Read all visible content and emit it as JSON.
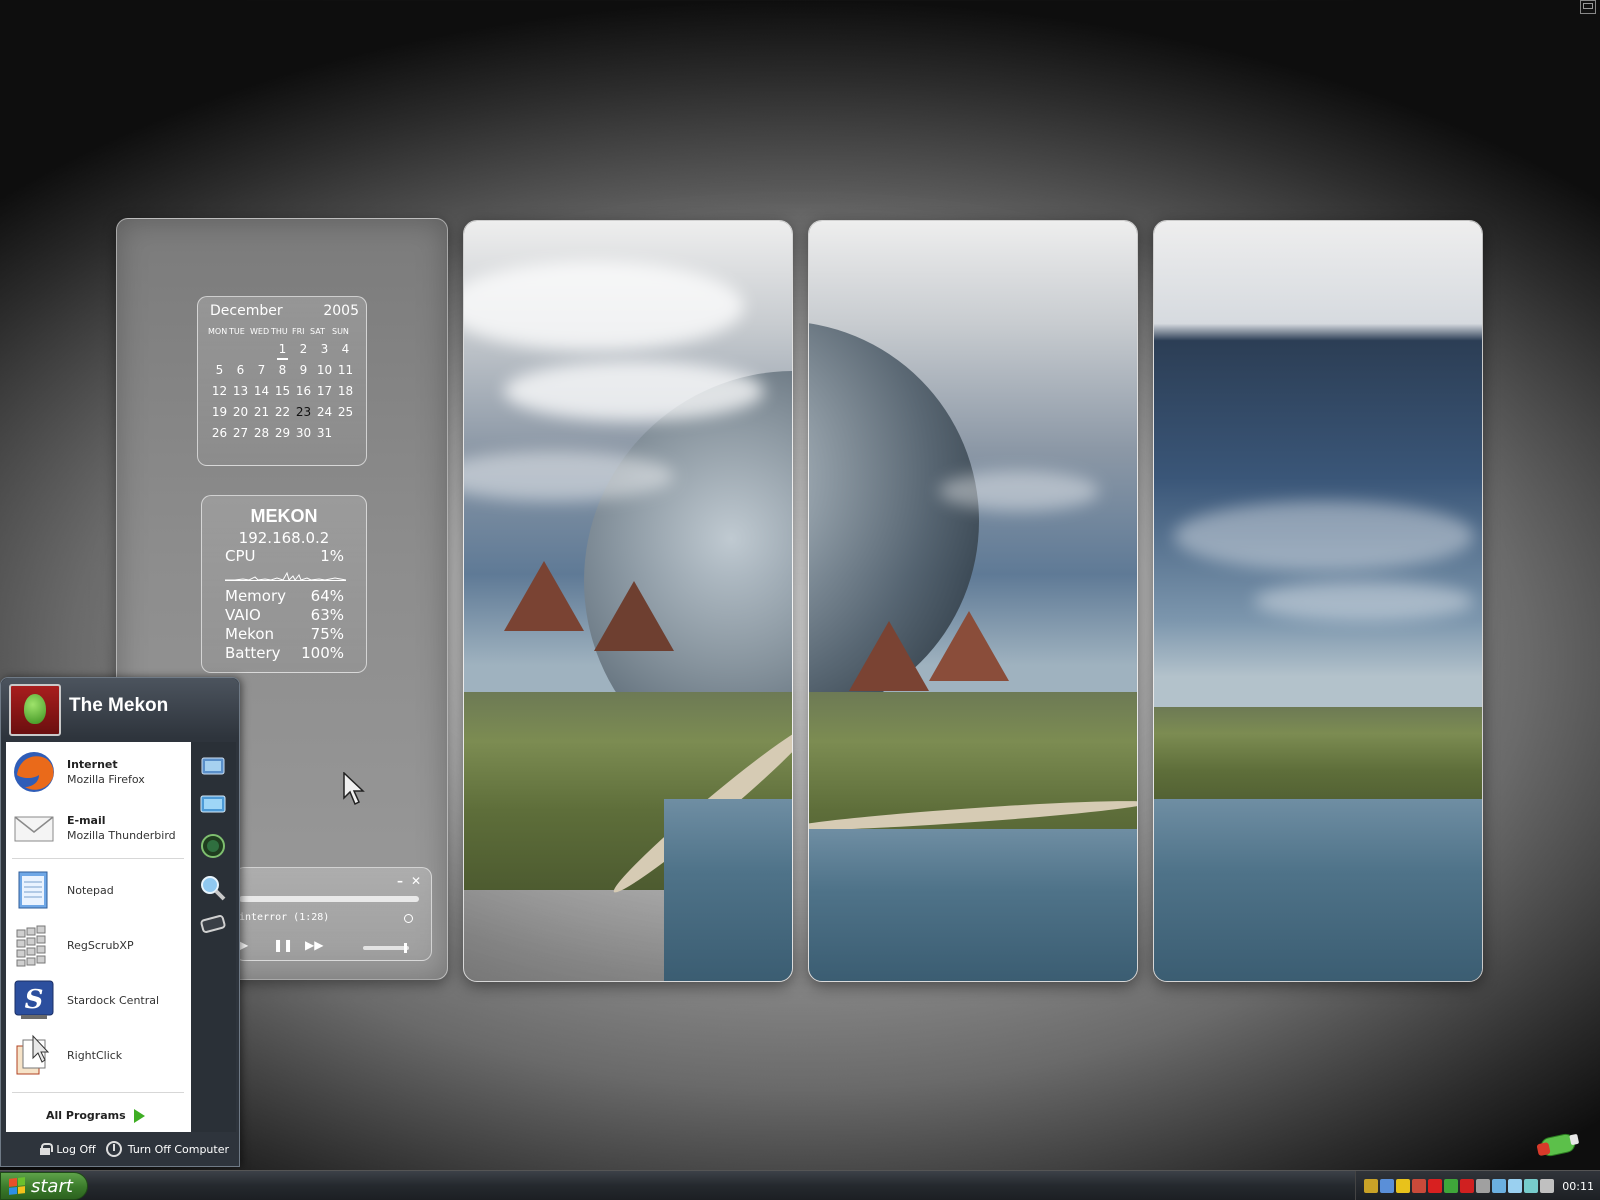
{
  "calendar": {
    "month": "December",
    "year": "2005",
    "weekdays": [
      "MON",
      "TUE",
      "WED",
      "THU",
      "FRI",
      "SAT",
      "SUN"
    ],
    "days": [
      "",
      "",
      "",
      "1",
      "2",
      "3",
      "4",
      "5",
      "6",
      "7",
      "8",
      "9",
      "10",
      "11",
      "12",
      "13",
      "14",
      "15",
      "16",
      "17",
      "18",
      "19",
      "20",
      "21",
      "22",
      "23",
      "24",
      "25",
      "26",
      "27",
      "28",
      "29",
      "30",
      "31",
      ""
    ],
    "today": "23"
  },
  "system_monitor": {
    "hostname": "MEKON",
    "ip": "192.168.0.2",
    "cpu_label": "CPU",
    "cpu_value": "1%",
    "rows": [
      {
        "label": "Memory",
        "value": "64%"
      },
      {
        "label": "VAIO",
        "value": "63%"
      },
      {
        "label": "Mekon",
        "value": "75%"
      },
      {
        "label": "Battery",
        "value": "100%"
      }
    ]
  },
  "media_player": {
    "minimize": "–",
    "close": "✕",
    "track": "interror (1:28)",
    "play_label": "▶",
    "pause_label": "❚❚",
    "next_label": "▶▶"
  },
  "start_menu": {
    "user_name": "The Mekon",
    "pinned": [
      {
        "title": "Internet",
        "subtitle": "Mozilla Firefox",
        "icon": "firefox-icon"
      },
      {
        "title": "E-mail",
        "subtitle": "Mozilla Thunderbird",
        "icon": "thunderbird-icon"
      }
    ],
    "recent": [
      {
        "label": "Notepad",
        "icon": "notepad-icon"
      },
      {
        "label": "RegScrubXP",
        "icon": "regscrubxp-icon"
      },
      {
        "label": "Stardock Central",
        "icon": "stardock-icon"
      },
      {
        "label": "RightClick",
        "icon": "rightclick-icon"
      }
    ],
    "all_programs": "All Programs",
    "log_off": "Log Off",
    "turn_off": "Turn Off Computer",
    "side_icons": [
      "pictures-icon",
      "computer-icon",
      "network-icon",
      "search-icon",
      "run-icon"
    ]
  },
  "taskbar": {
    "start_label": "start",
    "clock": "00:11",
    "tray_colors": [
      "#c9a227",
      "#5a8fd8",
      "#e8c21b",
      "#c94a3a",
      "#d82020",
      "#3fa63a",
      "#d02020",
      "#a0a0a0",
      "#6bb0e0",
      "#9ad0f0",
      "#7cc",
      "#c0c0c0"
    ]
  },
  "colors": {
    "start_green": "#3a7a2a",
    "menu_dark": "#2e343c"
  }
}
